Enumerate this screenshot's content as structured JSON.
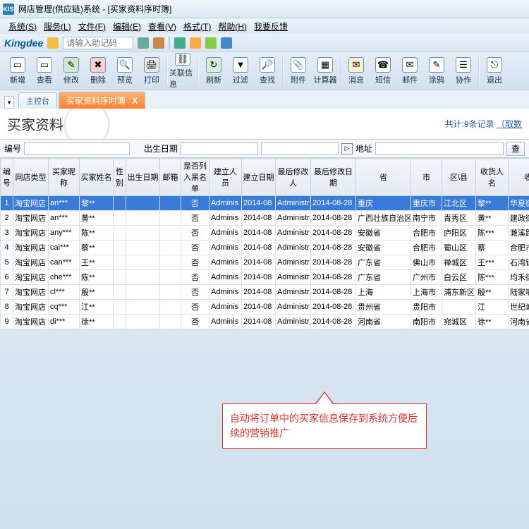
{
  "title": "网店管理(供应链)系统 - [买家资料序时簿]",
  "app_icon": "KIS",
  "menu": [
    "系统(S)",
    "服务(L)",
    "文件(F)",
    "编辑(E)",
    "查看(V)",
    "格式(T)",
    "帮助(H)",
    "我要反馈"
  ],
  "brand": "Kingdee",
  "help_placeholder": "请输入助记码",
  "toolbar": [
    {
      "lb": "新增",
      "ic": "▭",
      "c": "#fff"
    },
    {
      "lb": "查看",
      "ic": "▭",
      "c": "#fff"
    },
    {
      "lb": "修改",
      "ic": "✎",
      "c": "#cfe8cf"
    },
    {
      "lb": "删除",
      "ic": "✖",
      "c": "#f8d0d0"
    },
    {
      "lb": "预览",
      "ic": "🔍",
      "c": "#fff"
    },
    {
      "lb": "打印",
      "ic": "🖨",
      "c": "#e8e8e8"
    },
    {
      "sep": true
    },
    {
      "lb": "关联信息",
      "ic": "⛓",
      "c": "#fff"
    },
    {
      "sep": true
    },
    {
      "lb": "刷新",
      "ic": "↻",
      "c": "#d8f0d8"
    },
    {
      "lb": "过滤",
      "ic": "▼",
      "c": "#fff"
    },
    {
      "lb": "查找",
      "ic": "🔎",
      "c": "#fff"
    },
    {
      "sep": true
    },
    {
      "lb": "附件",
      "ic": "📎",
      "c": "#fff"
    },
    {
      "lb": "计算器",
      "ic": "▦",
      "c": "#fff"
    },
    {
      "sep": true
    },
    {
      "lb": "消息",
      "ic": "✉",
      "c": "#fff0d0"
    },
    {
      "lb": "短信",
      "ic": "☎",
      "c": "#fff"
    },
    {
      "lb": "邮件",
      "ic": "✉",
      "c": "#fff"
    },
    {
      "lb": "涂鸦",
      "ic": "✎",
      "c": "#fff"
    },
    {
      "lb": "协作",
      "ic": "☰",
      "c": "#fff"
    },
    {
      "sep": true
    },
    {
      "lb": "退出",
      "ic": "⎋",
      "c": "#fff"
    }
  ],
  "tabs": {
    "inactive": "主控台",
    "active": "买家资料序时簿",
    "close": "X"
  },
  "banner": {
    "title": "买家资料",
    "summary_prefix": "共计:",
    "count": "9",
    "summary_suffix": "条记录",
    "link": "（取数"
  },
  "filters": {
    "l1": "编号",
    "l2": "出生日期",
    "l3": "地址",
    "btn": "查"
  },
  "columns": [
    "编号",
    "网店类型",
    "买家昵称",
    "买家姓名",
    "性别",
    "出生日期",
    "邮箱",
    "是否列入黑名单",
    "建立人员",
    "建立日期",
    "最后修改人",
    "最后修改日期",
    "省",
    "市",
    "区\\县",
    "收货人名",
    "收"
  ],
  "rows": [
    {
      "n": "1",
      "shop": "淘宝网店",
      "nick": "an***",
      "name": "黎**",
      "bl": "否",
      "cp": "Adminis",
      "cd": "2014-08",
      "mp": "Administr",
      "md": "2014-08-28",
      "prov": "重庆",
      "city": "重庆市",
      "dist": "江北区",
      "recv": "黎**",
      "addr": "华夏街街道"
    },
    {
      "n": "2",
      "shop": "淘宝网店",
      "nick": "an***",
      "name": "黄**",
      "bl": "否",
      "cp": "Adminis",
      "cd": "2014-08",
      "mp": "Administr",
      "md": "2014-08-28",
      "prov": "广西壮族自治区",
      "city": "南宁市",
      "dist": "青秀区",
      "recv": "黄**",
      "addr": "建政街道南"
    },
    {
      "n": "3",
      "shop": "淘宝网店",
      "nick": "any***",
      "name": "陈**",
      "bl": "否",
      "cp": "Adminis",
      "cd": "2014-08",
      "mp": "Administr",
      "md": "2014-08-28",
      "prov": "安徽省",
      "city": "合肥市",
      "dist": "庐阳区",
      "recv": "陈***",
      "addr": "濉溪路"
    },
    {
      "n": "4",
      "shop": "淘宝网店",
      "nick": "cai***",
      "name": "蔡**",
      "bl": "否",
      "cp": "Adminis",
      "cd": "2014-08",
      "mp": "Administr",
      "md": "2014-08-28",
      "prov": "安徽省",
      "city": "合肥市",
      "dist": "蜀山区",
      "recv": "蔡",
      "addr": "合肥市金寨"
    },
    {
      "n": "5",
      "shop": "淘宝网店",
      "nick": "can***",
      "name": "王**",
      "bl": "否",
      "cp": "Adminis",
      "cd": "2014-08",
      "mp": "Administr",
      "md": "2014-08-28",
      "prov": "广东省",
      "city": "佛山市",
      "dist": "禅城区",
      "recv": "王***",
      "addr": "石湾镇街道"
    },
    {
      "n": "6",
      "shop": "淘宝网店",
      "nick": "che***",
      "name": "陈**",
      "bl": "否",
      "cp": "Adminis",
      "cd": "2014-08",
      "mp": "Administr",
      "md": "2014-08-28",
      "prov": "广东省",
      "city": "广州市",
      "dist": "白云区",
      "recv": "陈***",
      "addr": "均禾街道罗"
    },
    {
      "n": "7",
      "shop": "淘宝网店",
      "nick": "cl***",
      "name": "殷**",
      "bl": "否",
      "cp": "Adminis",
      "cd": "2014-08",
      "mp": "Administr",
      "md": "2014-08-28",
      "prov": "上海",
      "city": "上海市",
      "dist": "浦东新区",
      "recv": "殷**",
      "addr": "陆家嘴街道"
    },
    {
      "n": "8",
      "shop": "淘宝网店",
      "nick": "cq***",
      "name": "江**",
      "bl": "否",
      "cp": "Adminis",
      "cd": "2014-08",
      "mp": "Administr",
      "md": "2014-08-28",
      "prov": "贵州省",
      "city": "贵阳市",
      "dist": "",
      "recv": "江",
      "addr": "世纪城"
    },
    {
      "n": "9",
      "shop": "淘宝网店",
      "nick": "di***",
      "name": "徐**",
      "bl": "否",
      "cp": "Adminis",
      "cd": "2014-08",
      "mp": "Administr",
      "md": "2014-08-28",
      "prov": "河南省",
      "city": "南阳市",
      "dist": "宛城区",
      "recv": "徐**",
      "addr": "河南省南阳"
    }
  ],
  "callout": "自动将订单中的买家信息保存到系统方便后续的营销推广"
}
